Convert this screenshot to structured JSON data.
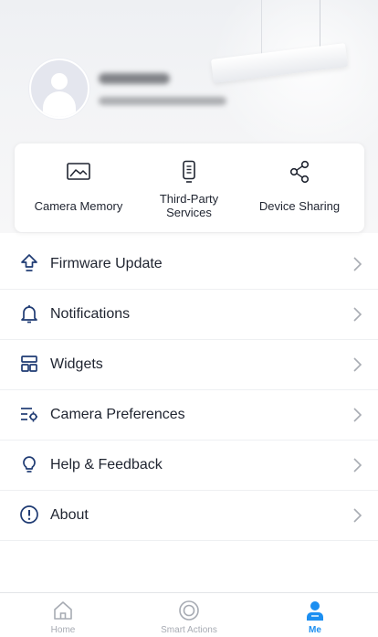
{
  "profile": {
    "name_redacted": "",
    "email_redacted": ""
  },
  "quick_actions": [
    {
      "label": "Camera Memory",
      "icon": "image-frame-icon"
    },
    {
      "label": "Third-Party\nServices",
      "icon": "remote-device-icon"
    },
    {
      "label": "Device Sharing",
      "icon": "share-icon"
    }
  ],
  "menu": [
    {
      "label": "Firmware Update",
      "icon": "upload-arrow-icon"
    },
    {
      "label": "Notifications",
      "icon": "bell-icon"
    },
    {
      "label": "Widgets",
      "icon": "widgets-icon"
    },
    {
      "label": "Camera Preferences",
      "icon": "preferences-icon"
    },
    {
      "label": "Help & Feedback",
      "icon": "lightbulb-icon"
    },
    {
      "label": "About",
      "icon": "info-icon"
    }
  ],
  "tabs": [
    {
      "label": "Home",
      "icon": "home-icon",
      "active": false
    },
    {
      "label": "Smart Actions",
      "icon": "smart-actions-icon",
      "active": false
    },
    {
      "label": "Me",
      "icon": "person-icon",
      "active": true
    }
  ],
  "colors": {
    "accent": "#1c8ff1",
    "icon_navy": "#1f3b73",
    "text": "#1f2430",
    "tab_inactive": "#a7abb3"
  }
}
